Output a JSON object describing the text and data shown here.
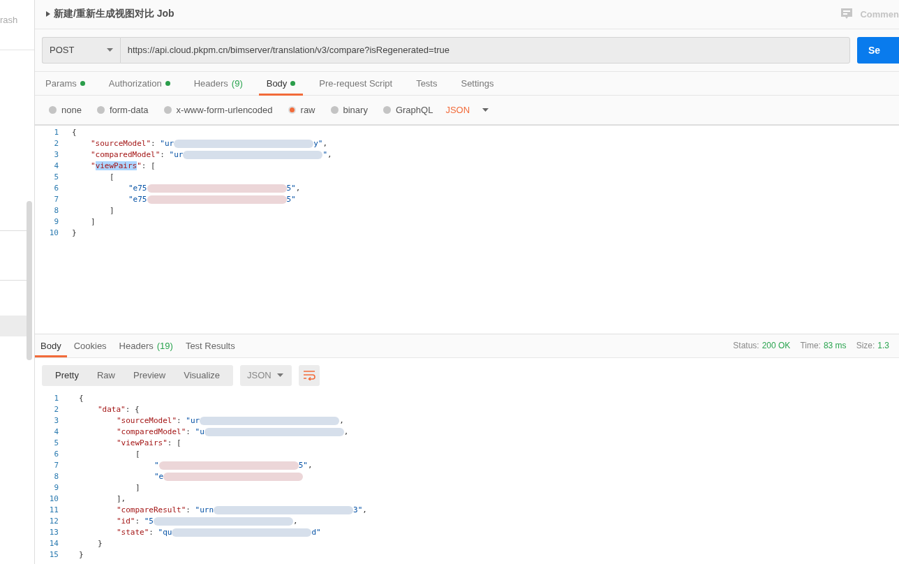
{
  "sidebar": {
    "trash_label": "rash"
  },
  "request": {
    "title": "新建/重新生成视图对比 Job",
    "comments_label": "Commen",
    "method": "POST",
    "url": "https://api.cloud.pkpm.cn/bimserver/translation/v3/compare?isRegenerated=true",
    "send_label": "Se",
    "tabs": [
      {
        "label": "Params",
        "dot": true,
        "selected": false
      },
      {
        "label": "Authorization",
        "dot": true,
        "selected": false
      },
      {
        "label": "Headers",
        "count": "(9)",
        "dot": false,
        "selected": false
      },
      {
        "label": "Body",
        "dot": true,
        "selected": true
      },
      {
        "label": "Pre-request Script",
        "dot": false,
        "selected": false
      },
      {
        "label": "Tests",
        "dot": false,
        "selected": false
      },
      {
        "label": "Settings",
        "dot": false,
        "selected": false
      }
    ],
    "body_types": [
      {
        "label": "none",
        "selected": false
      },
      {
        "label": "form-data",
        "selected": false
      },
      {
        "label": "x-www-form-urlencoded",
        "selected": false
      },
      {
        "label": "raw",
        "selected": true
      },
      {
        "label": "binary",
        "selected": false
      },
      {
        "label": "GraphQL",
        "selected": false
      }
    ],
    "format": "JSON",
    "code": [
      {
        "num": "1",
        "tokens": [
          {
            "kind": "punct",
            "text": "{"
          }
        ],
        "children": [
          {
            "num": "2",
            "tokens": [
              {
                "kind": "key",
                "text": "\"sourceModel\""
              },
              {
                "kind": "punct",
                "text": ":"
              },
              {
                "kind": "str",
                "text": "\"ur"
              },
              {
                "kind": "redacted",
                "color": "#d6dfeb"
              },
              {
                "kind": "str",
                "text": "y\""
              },
              {
                "kind": "punct",
                "text": ","
              }
            ]
          },
          {
            "num": "3",
            "tokens": [
              {
                "kind": "key",
                "text": "\"comparedModel\""
              },
              {
                "kind": "punct",
                "text": ":"
              },
              {
                "kind": "str",
                "text": "\"ur"
              },
              {
                "kind": "redacted",
                "color": "#d6dfeb"
              },
              {
                "kind": "str",
                "text": "\""
              },
              {
                "kind": "punct",
                "text": ","
              }
            ]
          },
          {
            "num": "4",
            "tokens": [
              {
                "kind": "key",
                "text": "\""
              },
              {
                "kind": "selection",
                "text": "viewPairs"
              },
              {
                "kind": "key",
                "text": "\""
              },
              {
                "kind": "punct",
                "text": ":"
              },
              {
                "kind": "punct",
                "text": "["
              }
            ],
            "children": [
              {
                "num": "5",
                "tokens": [
                  {
                    "kind": "punct",
                    "text": "["
                  }
                ],
                "children": [
                  {
                    "num": "6",
                    "tokens": [
                      {
                        "kind": "str",
                        "text": "\"e75"
                      },
                      {
                        "kind": "redacted",
                        "color": "#ecd6d8"
                      },
                      {
                        "kind": "str",
                        "text": "5\""
                      },
                      {
                        "kind": "punct",
                        "text": ","
                      }
                    ]
                  },
                  {
                    "num": "7",
                    "tokens": [
                      {
                        "kind": "str",
                        "text": "\"e75"
                      },
                      {
                        "kind": "redacted",
                        "color": "#ecd6d8"
                      },
                      {
                        "kind": "str",
                        "text": "5\""
                      }
                    ]
                  }
                ]
              },
              {
                "num": "8",
                "tokens": [
                  {
                    "kind": "punct",
                    "text": "]"
                  }
                ]
              }
            ]
          },
          {
            "num": "9",
            "tokens": [
              {
                "kind": "punct",
                "text": "]"
              }
            ]
          }
        ]
      },
      {
        "num": "10",
        "tokens": [
          {
            "kind": "punct",
            "text": "}"
          }
        ]
      }
    ]
  },
  "response": {
    "tabs": [
      {
        "label": "Body",
        "selected": true
      },
      {
        "label": "Cookies",
        "selected": false
      },
      {
        "label": "Headers",
        "count": "(19)",
        "selected": false
      },
      {
        "label": "Test Results",
        "selected": false
      }
    ],
    "stats": [
      {
        "label": "Status:",
        "value": "200 OK"
      },
      {
        "label": "Time:",
        "value": "83 ms"
      },
      {
        "label": "Size:",
        "value": "1.3"
      }
    ],
    "views": [
      {
        "label": "Pretty",
        "selected": true
      },
      {
        "label": "Raw",
        "selected": false
      },
      {
        "label": "Preview",
        "selected": false
      },
      {
        "label": "Visualize",
        "selected": false
      }
    ],
    "format": "JSON",
    "code": [
      {
        "num": "1",
        "tokens": [
          {
            "kind": "punct",
            "text": "{"
          }
        ],
        "children": [
          {
            "num": "2",
            "tokens": [
              {
                "kind": "key",
                "text": "\"data\""
              },
              {
                "kind": "punct",
                "text": ":"
              },
              {
                "kind": "punct",
                "text": "{"
              }
            ],
            "children": [
              {
                "num": "3",
                "tokens": [
                  {
                    "kind": "key",
                    "text": "\"sourceModel\""
                  },
                  {
                    "kind": "punct",
                    "text": ":"
                  },
                  {
                    "kind": "str",
                    "text": "\"ur"
                  },
                  {
                    "kind": "redacted",
                    "color": "#d6dfeb"
                  },
                  {
                    "kind": "punct",
                    "text": ","
                  }
                ]
              },
              {
                "num": "4",
                "tokens": [
                  {
                    "kind": "key",
                    "text": "\"comparedModel\""
                  },
                  {
                    "kind": "punct",
                    "text": ":"
                  },
                  {
                    "kind": "str",
                    "text": "\"u"
                  },
                  {
                    "kind": "redacted",
                    "color": "#d6dfeb"
                  },
                  {
                    "kind": "punct",
                    "text": ","
                  }
                ]
              },
              {
                "num": "5",
                "tokens": [
                  {
                    "kind": "key",
                    "text": "\"viewPairs\""
                  },
                  {
                    "kind": "punct",
                    "text": ":"
                  },
                  {
                    "kind": "punct",
                    "text": "["
                  }
                ],
                "children": [
                  {
                    "num": "6",
                    "tokens": [
                      {
                        "kind": "punct",
                        "text": "["
                      }
                    ],
                    "children": [
                      {
                        "num": "7",
                        "tokens": [
                          {
                            "kind": "str",
                            "text": "\""
                          },
                          {
                            "kind": "redacted",
                            "color": "#ecd6d8"
                          },
                          {
                            "kind": "str",
                            "text": "5\""
                          },
                          {
                            "kind": "punct",
                            "text": ","
                          }
                        ]
                      },
                      {
                        "num": "8",
                        "tokens": [
                          {
                            "kind": "str",
                            "text": "\"e"
                          },
                          {
                            "kind": "redacted",
                            "color": "#ecd6d8"
                          }
                        ]
                      }
                    ]
                  },
                  {
                    "num": "9",
                    "tokens": [
                      {
                        "kind": "punct",
                        "text": "]"
                      }
                    ]
                  }
                ]
              },
              {
                "num": "10",
                "tokens": [
                  {
                    "kind": "punct",
                    "text": "],"
                  }
                ]
              },
              {
                "num": "11",
                "tokens": [
                  {
                    "kind": "key",
                    "text": "\"compareResult\""
                  },
                  {
                    "kind": "punct",
                    "text": ":"
                  },
                  {
                    "kind": "str",
                    "text": "\"urn"
                  },
                  {
                    "kind": "redacted",
                    "color": "#d6dfeb"
                  },
                  {
                    "kind": "str",
                    "text": "3\""
                  },
                  {
                    "kind": "punct",
                    "text": ","
                  }
                ]
              },
              {
                "num": "12",
                "tokens": [
                  {
                    "kind": "key",
                    "text": "\"id\""
                  },
                  {
                    "kind": "punct",
                    "text": ":"
                  },
                  {
                    "kind": "str",
                    "text": "\"5"
                  },
                  {
                    "kind": "redacted",
                    "color": "#d6dfeb"
                  },
                  {
                    "kind": "punct",
                    "text": ","
                  }
                ]
              },
              {
                "num": "13",
                "tokens": [
                  {
                    "kind": "key",
                    "text": "\"state\""
                  },
                  {
                    "kind": "punct",
                    "text": ":"
                  },
                  {
                    "kind": "str",
                    "text": "\"qu"
                  },
                  {
                    "kind": "redacted",
                    "color": "#d6dfeb"
                  },
                  {
                    "kind": "str",
                    "text": "d\""
                  }
                ]
              }
            ]
          },
          {
            "num": "14",
            "tokens": [
              {
                "kind": "punct",
                "text": "}"
              }
            ]
          }
        ]
      },
      {
        "num": "15",
        "tokens": [
          {
            "kind": "punct",
            "text": "}"
          }
        ]
      }
    ]
  }
}
